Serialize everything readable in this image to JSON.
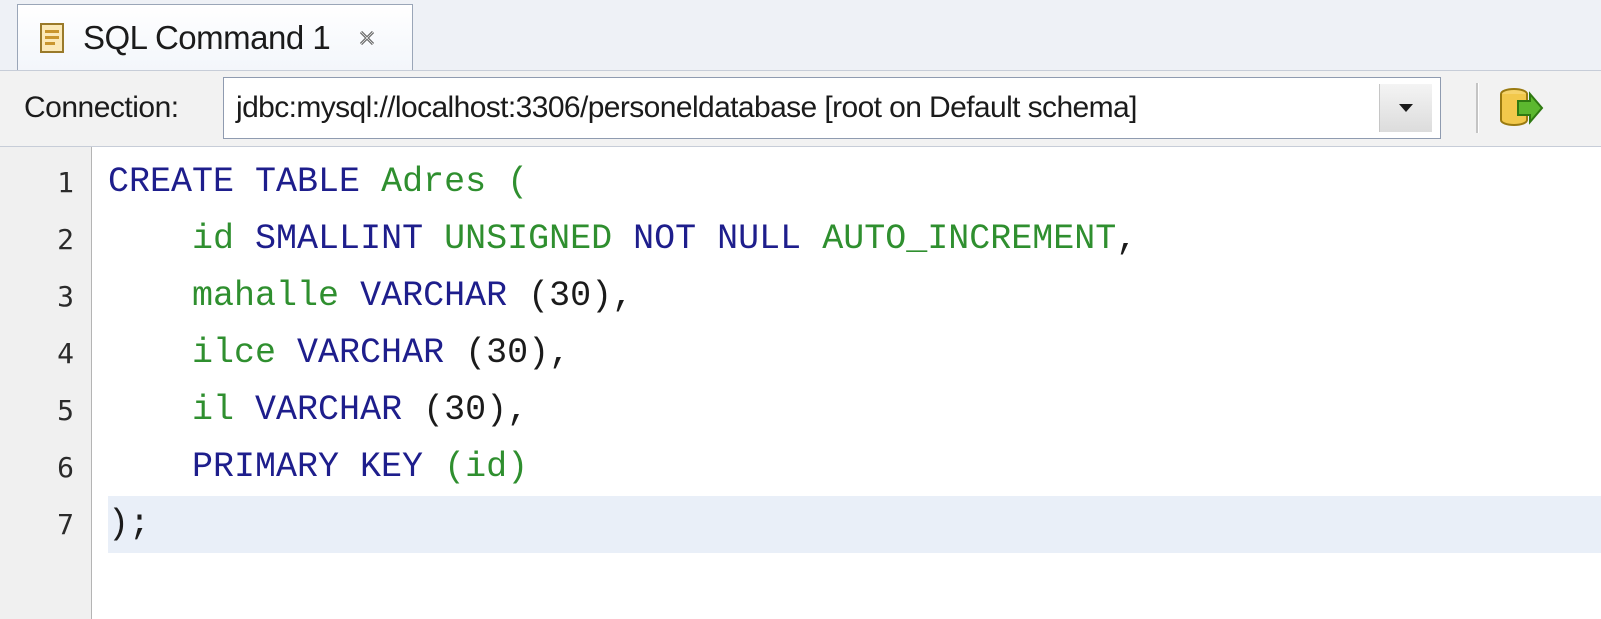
{
  "tab": {
    "label": "SQL Command 1",
    "icon": "sql-file-icon",
    "close_icon": "close-tab-icon"
  },
  "toolbar": {
    "connection_label": "Connection:",
    "connection_value": "jdbc:mysql://localhost:3306/personeldatabase [root on Default schema]",
    "dropdown_icon": "chevron-down-icon",
    "run_icon": "run-sql-icon"
  },
  "editor": {
    "current_line": 7,
    "lines": [
      {
        "num": "1",
        "indent": "",
        "tokens": [
          {
            "t": "CREATE TABLE",
            "c": "kw"
          },
          {
            "t": " ",
            "c": "pn"
          },
          {
            "t": "Adres",
            "c": "id"
          },
          {
            "t": " (",
            "c": "id"
          }
        ]
      },
      {
        "num": "2",
        "indent": "    ",
        "tokens": [
          {
            "t": "id",
            "c": "id"
          },
          {
            "t": " ",
            "c": "pn"
          },
          {
            "t": "SMALLINT",
            "c": "kw"
          },
          {
            "t": " ",
            "c": "pn"
          },
          {
            "t": "UNSIGNED",
            "c": "id"
          },
          {
            "t": " ",
            "c": "pn"
          },
          {
            "t": "NOT NULL",
            "c": "kw"
          },
          {
            "t": " ",
            "c": "pn"
          },
          {
            "t": "AUTO_INCREMENT",
            "c": "id"
          },
          {
            "t": ",",
            "c": "pn"
          }
        ]
      },
      {
        "num": "3",
        "indent": "    ",
        "tokens": [
          {
            "t": "mahalle",
            "c": "id"
          },
          {
            "t": " ",
            "c": "pn"
          },
          {
            "t": "VARCHAR",
            "c": "kw"
          },
          {
            "t": " (",
            "c": "pn"
          },
          {
            "t": "30",
            "c": "num"
          },
          {
            "t": "),",
            "c": "pn"
          }
        ]
      },
      {
        "num": "4",
        "indent": "    ",
        "tokens": [
          {
            "t": "ilce",
            "c": "id"
          },
          {
            "t": " ",
            "c": "pn"
          },
          {
            "t": "VARCHAR",
            "c": "kw"
          },
          {
            "t": " (",
            "c": "pn"
          },
          {
            "t": "30",
            "c": "num"
          },
          {
            "t": "),",
            "c": "pn"
          }
        ]
      },
      {
        "num": "5",
        "indent": "    ",
        "tokens": [
          {
            "t": "il",
            "c": "id"
          },
          {
            "t": " ",
            "c": "pn"
          },
          {
            "t": "VARCHAR",
            "c": "kw"
          },
          {
            "t": " (",
            "c": "pn"
          },
          {
            "t": "30",
            "c": "num"
          },
          {
            "t": "),",
            "c": "pn"
          }
        ]
      },
      {
        "num": "6",
        "indent": "    ",
        "tokens": [
          {
            "t": "PRIMARY KEY",
            "c": "kw"
          },
          {
            "t": " ",
            "c": "pn"
          },
          {
            "t": "(id)",
            "c": "id"
          }
        ]
      },
      {
        "num": "7",
        "indent": "",
        "tokens": [
          {
            "t": ");",
            "c": "pn"
          }
        ]
      }
    ]
  }
}
